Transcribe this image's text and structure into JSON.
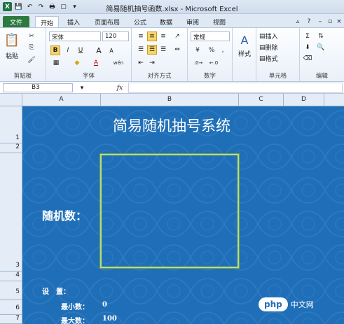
{
  "window": {
    "title": "简易随机抽号函数.xlsx - Microsoft Excel"
  },
  "tabs": [
    "文件",
    "开始",
    "插入",
    "页面布局",
    "公式",
    "数据",
    "审阅",
    "视图"
  ],
  "ribbon": {
    "clipboard": {
      "label": "剪贴板",
      "paste": "粘贴"
    },
    "font": {
      "label": "字体",
      "name": "宋体",
      "size": "120",
      "bold": "B",
      "italic": "I",
      "underline": "U",
      "grow": "A",
      "shrink": "A",
      "font_color": "A",
      "phonetic": "wén"
    },
    "alignment": {
      "label": "对齐方式"
    },
    "number": {
      "label": "数字",
      "format": "常规",
      "percent": "%"
    },
    "styles": {
      "label": "样式"
    },
    "cells": {
      "label": "单元格",
      "insert": "插入",
      "delete": "删除",
      "format": "格式"
    },
    "editing": {
      "label": "编辑"
    }
  },
  "formula_bar": {
    "cell_ref": "B3",
    "fx": "fx"
  },
  "columns": [
    "A",
    "B",
    "C",
    "D"
  ],
  "rows": [
    "1",
    "2",
    "3",
    "4",
    "5",
    "6",
    "7"
  ],
  "sheet": {
    "title": "简易随机抽号系统",
    "random_label": "随机数：",
    "settings_label": "设　置：",
    "min_label": "最小数：",
    "min_value": "0",
    "max_label": "最大数：",
    "max_value": "100"
  },
  "watermark": {
    "badge": "php",
    "text": "中文网"
  },
  "colors": {
    "sheet_bg": "#1f6fb8",
    "file_tab": "#2c7a3f",
    "box_border": "#b8e07a"
  }
}
